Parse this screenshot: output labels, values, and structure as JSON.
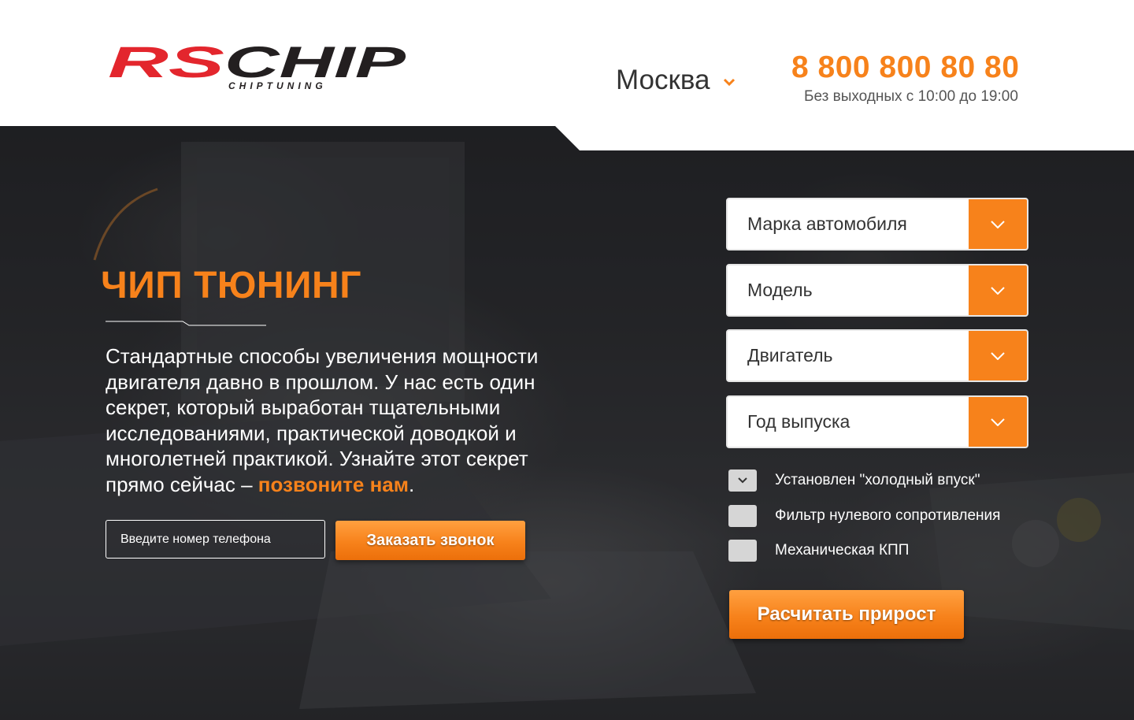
{
  "header": {
    "logo_text": "RSCHIP",
    "logo_subtext": "CHIPTUNING",
    "city": "Москва",
    "phone": "8 800 800 80 80",
    "hours": "Без выходных с 10:00 до 19:00"
  },
  "hero": {
    "title": "ЧИП ТЮНИНГ",
    "description_main": "Стандартные способы увеличения мощности двигателя давно в прошлом. У нас есть один секрет, который выработан тщательными исследованиями, практической доводкой и многолетней практикой. Узнайте этот секрет прямо сейчас – ",
    "description_highlight": "позвоните нам",
    "description_end": ".",
    "phone_placeholder": "Введите номер телефона",
    "call_button": "Заказать звонок"
  },
  "form": {
    "selects": [
      "Марка автомобиля",
      "Модель",
      "Двигатель",
      "Год выпуска"
    ],
    "checkboxes": [
      {
        "label": "Установлен \"холодный впуск\"",
        "checked": true
      },
      {
        "label": "Фильтр нулевого сопротивления",
        "checked": false
      },
      {
        "label": "Механическая КПП",
        "checked": false
      }
    ],
    "submit": "Расчитать прирост"
  },
  "colors": {
    "accent": "#f7821b",
    "logo_red": "#e3262d",
    "logo_dark": "#231f20"
  }
}
